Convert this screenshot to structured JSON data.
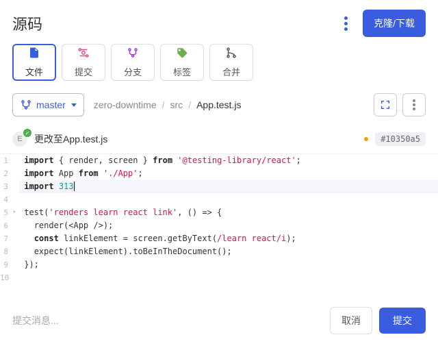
{
  "header": {
    "title": "源码",
    "clone_label": "克隆/下载"
  },
  "tabs": [
    {
      "label": "文件",
      "icon": "file"
    },
    {
      "label": "提交",
      "icon": "commit"
    },
    {
      "label": "分支",
      "icon": "branch"
    },
    {
      "label": "标签",
      "icon": "tag"
    },
    {
      "label": "合并",
      "icon": "merge"
    }
  ],
  "branch": {
    "name": "master"
  },
  "breadcrumb": {
    "parts": [
      "zero-downtime",
      "src"
    ],
    "current": "App.test.js"
  },
  "commit_bar": {
    "avatar_initial": "E",
    "message": "更改至App.test.js",
    "hash": "#10350a5"
  },
  "code": {
    "lines": [
      {
        "n": 1
      },
      {
        "n": 2
      },
      {
        "n": 3,
        "highlight": true,
        "edit_token": "313"
      },
      {
        "n": 4
      },
      {
        "n": 5,
        "fold": true
      },
      {
        "n": 6
      },
      {
        "n": 7
      },
      {
        "n": 8
      },
      {
        "n": 9
      },
      {
        "n": 10
      }
    ],
    "tokens": {
      "import": "import",
      "from": "from",
      "render": "render",
      "screen": "screen",
      "App": "App",
      "test": "test",
      "const": "const",
      "linkElement": "linkElement",
      "expect": "expect",
      "string_lib": "'@testing-library/react'",
      "string_app": "'./App'",
      "string_test": "'renders learn react link'",
      "regex": "/learn react/i",
      "render_call": "render(<App />);",
      "getByText_pre": "screen.getByText(",
      "getByText_post": ");",
      "toBeInDoc": ").toBeInTheDocument();",
      "arrow": "() => {",
      "close_brace": "});"
    }
  },
  "footer": {
    "placeholder": "提交消息...",
    "cancel": "取消",
    "submit": "提交"
  }
}
